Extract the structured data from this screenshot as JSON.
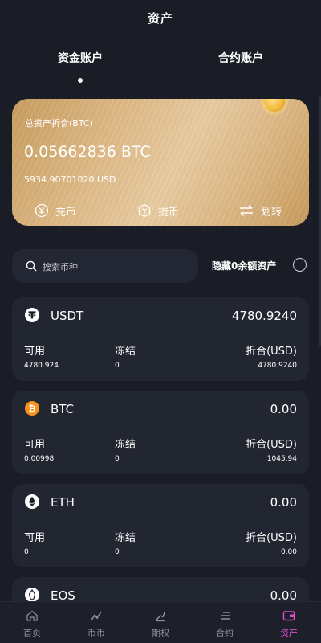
{
  "header": {
    "title": "资产"
  },
  "tabs": [
    {
      "label": "资金账户",
      "active": true
    },
    {
      "label": "合约账户",
      "active": false
    }
  ],
  "summary": {
    "label": "总资产折合(BTC)",
    "btc_value": "0.05662836 BTC",
    "usd_value": "5934.90701020 USD",
    "actions": [
      {
        "label": "充币",
        "icon": "deposit-icon"
      },
      {
        "label": "提币",
        "icon": "withdraw-icon"
      },
      {
        "label": "划转",
        "icon": "transfer-icon"
      }
    ]
  },
  "search": {
    "placeholder": "搜索币种",
    "value": ""
  },
  "hide_zero": {
    "label": "隐藏0余额资产",
    "checked": false
  },
  "column_labels": {
    "available": "可用",
    "frozen": "冻结",
    "converted": "折合(USD)"
  },
  "assets": [
    {
      "symbol": "USDT",
      "total": "4780.9240",
      "available": "4780.924",
      "frozen": "0",
      "converted": "4780.9240",
      "icon": "usdt-icon",
      "color": "#26a17b"
    },
    {
      "symbol": "BTC",
      "total": "0.00",
      "available": "0.00998",
      "frozen": "0",
      "converted": "1045.94",
      "icon": "btc-icon",
      "color": "#f7931a"
    },
    {
      "symbol": "ETH",
      "total": "0.00",
      "available": "0",
      "frozen": "0",
      "converted": "0.00",
      "icon": "eth-icon",
      "color": "#ffffff"
    },
    {
      "symbol": "EOS",
      "total": "0.00",
      "icon": "eos-icon",
      "color": "#ffffff"
    }
  ],
  "nav": [
    {
      "label": "首页",
      "icon": "home-icon",
      "active": false
    },
    {
      "label": "币币",
      "icon": "spot-icon",
      "active": false
    },
    {
      "label": "期权",
      "icon": "options-icon",
      "active": false
    },
    {
      "label": "合约",
      "icon": "contract-icon",
      "active": false
    },
    {
      "label": "资产",
      "icon": "wallet-icon",
      "active": true
    }
  ],
  "colors": {
    "background": "#1a1d26",
    "card_bg": "#222630",
    "accent_gold": "#d9b37e",
    "nav_active": "#e04fd1",
    "nav_inactive": "#8b90a0"
  }
}
